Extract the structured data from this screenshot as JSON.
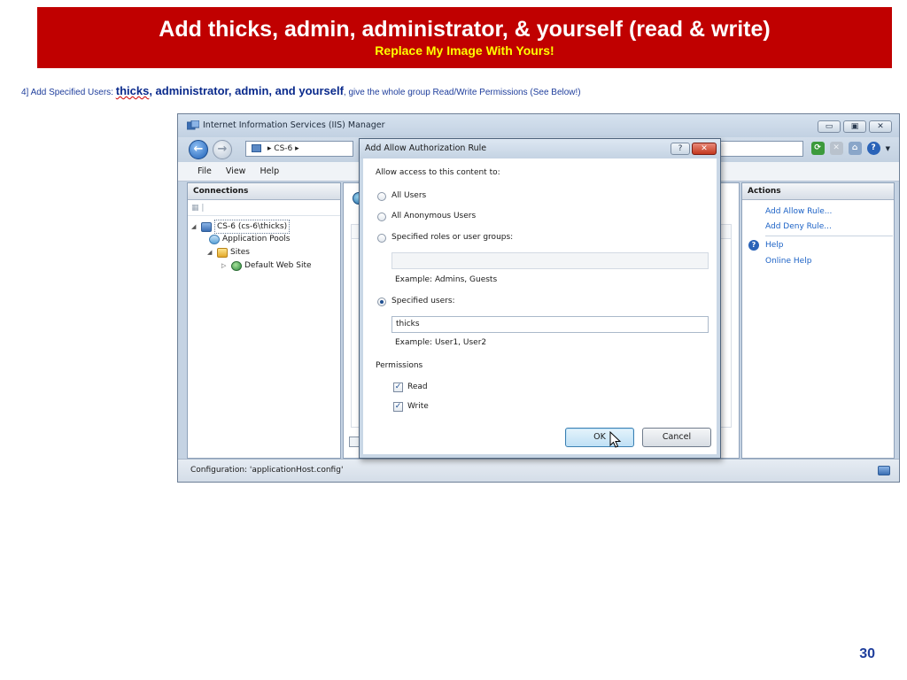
{
  "slide": {
    "title": "Add thicks, admin, administrator, & yourself (read & write)",
    "subtitle": "Replace My Image With Yours!",
    "instruction": {
      "prefix": "4] Add Specified Users:  ",
      "emph_thicks": "thicks",
      "emph_rest": ", administrator, admin, and yourself",
      "suffix": ", give the whole group Read/Write Permissions (See Below!)"
    },
    "page_number": "30"
  },
  "iis": {
    "window_title": "Internet Information Services (IIS) Manager",
    "window_buttons": [
      "▭",
      "▣",
      "✕"
    ],
    "address": {
      "separator": "▸",
      "node": "CS-6",
      "trailing": "▸"
    },
    "menu": [
      "File",
      "View",
      "Help"
    ],
    "connections": {
      "header": "Connections",
      "tree": {
        "server": "CS-6 (cs-6\\thicks)",
        "app_pools": "Application Pools",
        "sites": "Sites",
        "default_site": "Default Web Site"
      }
    },
    "actions": {
      "header": "Actions",
      "add_allow": "Add Allow Rule...",
      "add_deny": "Add Deny Rule...",
      "help": "Help",
      "online_help": "Online Help"
    },
    "status": "Configuration: 'applicationHost.config'",
    "icons": [
      "back-icon",
      "forward-icon",
      "server-icon",
      "refresh-icon",
      "home-icon",
      "help-icon"
    ]
  },
  "dialog": {
    "title": "Add Allow Authorization Rule",
    "help_btn": "?",
    "close_btn": "✕",
    "prompt": "Allow access to this content to:",
    "options": {
      "all_users": "All Users",
      "all_anonymous": "All Anonymous Users",
      "roles": "Specified roles or user groups:",
      "users": "Specified users:"
    },
    "selected_option": "users",
    "roles_value": "",
    "roles_example": "Example: Admins, Guests",
    "users_value": "thicks",
    "users_example": "Example: User1, User2",
    "permissions_label": "Permissions",
    "read_label": "Read",
    "write_label": "Write",
    "read_checked": true,
    "write_checked": true,
    "check_mark": "✓",
    "ok_label": "OK",
    "cancel_label": "Cancel"
  },
  "colors": {
    "slide_header_bg": "#c00000",
    "subtitle": "#ffff00",
    "instruction_text": "#1f3e9c",
    "link": "#1c62c6"
  }
}
